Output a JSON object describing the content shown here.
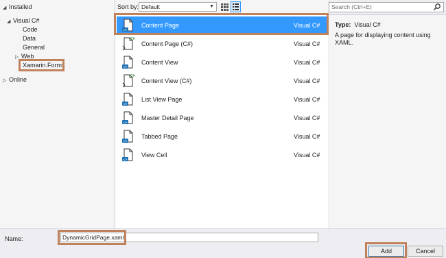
{
  "tree": {
    "installed": "Installed",
    "visual_csharp": "Visual C#",
    "code": "Code",
    "data": "Data",
    "general": "General",
    "web": "Web",
    "xamarin_forms": "Xamarin.Forms",
    "online": "Online"
  },
  "toolbar": {
    "sort_label": "Sort by:",
    "sort_value": "Default"
  },
  "search": {
    "placeholder": "Search (Ctrl+E)"
  },
  "templates": [
    {
      "name": "Content Page",
      "lang": "Visual C#",
      "icon": "xaml-page-icon",
      "selected": true
    },
    {
      "name": "Content Page (C#)",
      "lang": "Visual C#",
      "icon": "csharp-page-icon"
    },
    {
      "name": "Content View",
      "lang": "Visual C#",
      "icon": "xaml-page-icon"
    },
    {
      "name": "Content View (C#)",
      "lang": "Visual C#",
      "icon": "csharp-page-icon"
    },
    {
      "name": "List View Page",
      "lang": "Visual C#",
      "icon": "xaml-page-icon"
    },
    {
      "name": "Master Detail Page",
      "lang": "Visual C#",
      "icon": "xaml-page-icon"
    },
    {
      "name": "Tabbed Page",
      "lang": "Visual C#",
      "icon": "xaml-page-icon"
    },
    {
      "name": "View Cell",
      "lang": "Visual C#",
      "icon": "xaml-page-icon"
    }
  ],
  "info": {
    "type_label": "Type:",
    "type_value": "Visual C#",
    "description": "A page for displaying content using XAML."
  },
  "bottom": {
    "name_label": "Name:",
    "name_value": "DynamicGridPage.xaml",
    "add_label": "Add",
    "cancel_label": "Cancel"
  },
  "colors": {
    "selection": "#3399ff",
    "highlight_box": "#c0825a"
  }
}
